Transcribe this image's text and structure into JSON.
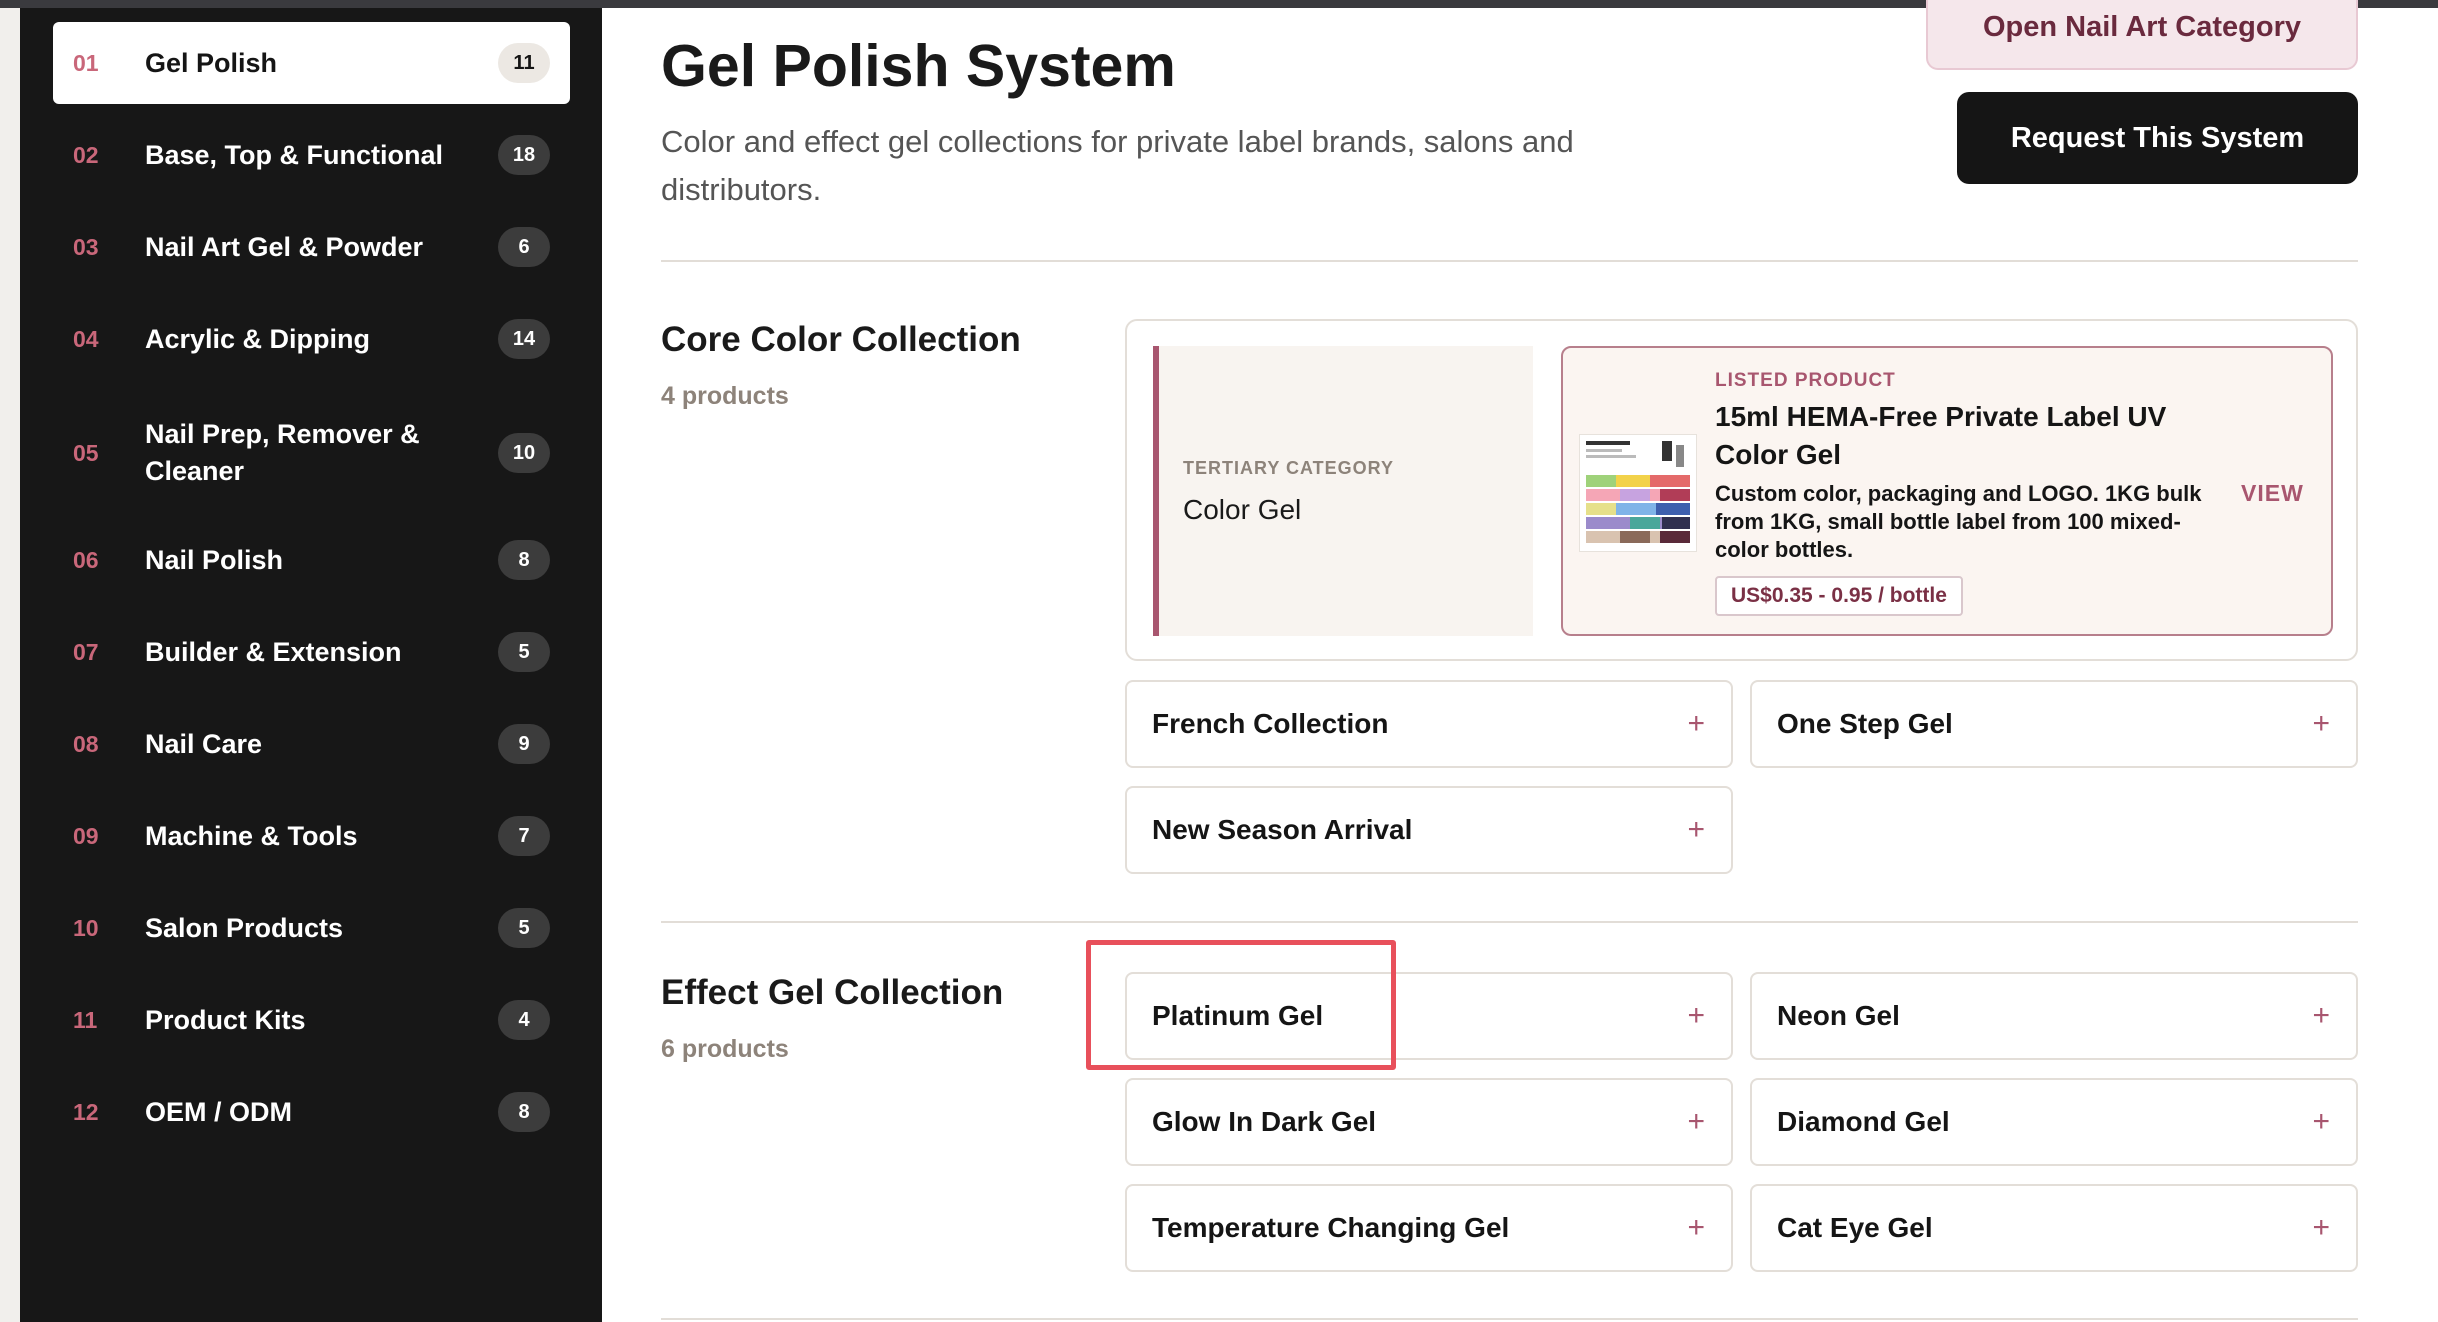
{
  "sidebar": {
    "items": [
      {
        "num": "01",
        "label": "Gel Polish",
        "count": "11",
        "active": true
      },
      {
        "num": "02",
        "label": "Base, Top & Functional",
        "count": "18"
      },
      {
        "num": "03",
        "label": "Nail Art Gel & Powder",
        "count": "6"
      },
      {
        "num": "04",
        "label": "Acrylic & Dipping",
        "count": "14"
      },
      {
        "num": "05",
        "label": "Nail Prep, Remover & Cleaner",
        "count": "10"
      },
      {
        "num": "06",
        "label": "Nail Polish",
        "count": "8"
      },
      {
        "num": "07",
        "label": "Builder & Extension",
        "count": "5"
      },
      {
        "num": "08",
        "label": "Nail Care",
        "count": "9"
      },
      {
        "num": "09",
        "label": "Machine & Tools",
        "count": "7"
      },
      {
        "num": "10",
        "label": "Salon Products",
        "count": "5"
      },
      {
        "num": "11",
        "label": "Product Kits",
        "count": "4"
      },
      {
        "num": "12",
        "label": "OEM / ODM",
        "count": "8"
      }
    ]
  },
  "header": {
    "title": "Gel Polish System",
    "description": "Color and effect gel collections for private label brands, salons and distributors.",
    "nail_art_button": "Open Nail Art Category",
    "request_button": "Request This System"
  },
  "sections": {
    "core": {
      "title": "Core Color Collection",
      "count": "4 products",
      "tertiary": {
        "caption": "TERTIARY CATEGORY",
        "name": "Color Gel"
      },
      "product": {
        "caption": "LISTED PRODUCT",
        "title": "15ml HEMA-Free Private Label UV Color Gel",
        "description": "Custom color, packaging and LOGO. 1KG bulk from 1KG, small bottle label from 100 mixed-color bottles.",
        "price": "US$0.35 - 0.95 / bottle",
        "view": "VIEW"
      },
      "items": [
        "French Collection",
        "One Step Gel",
        "New Season Arrival"
      ]
    },
    "effect": {
      "title": "Effect Gel Collection",
      "count": "6 products",
      "items": [
        "Platinum Gel",
        "Neon Gel",
        "Glow In Dark Gel",
        "Diamond Gel",
        "Temperature Changing Gel",
        "Cat Eye Gel"
      ]
    }
  },
  "plus_glyph": "+",
  "colors": {
    "accent": "#a8566f",
    "highlight": "#e8505b",
    "sidebar_bg": "#171717"
  }
}
